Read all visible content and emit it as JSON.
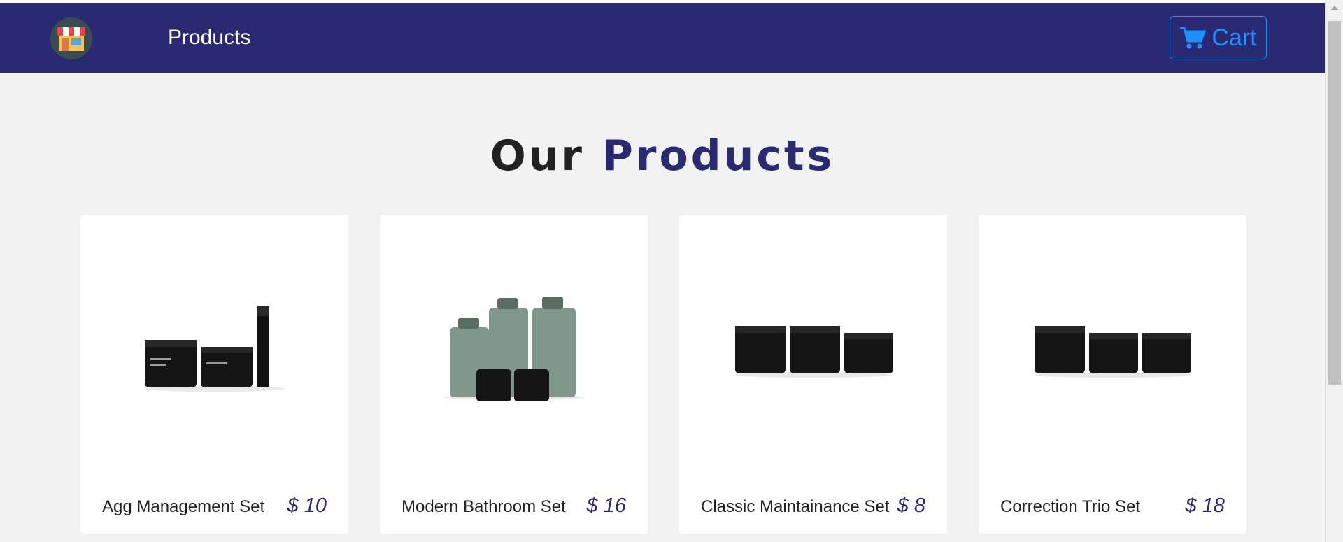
{
  "nav": {
    "logo_icon": "storefront-icon",
    "products_link": "Products",
    "cart_label": "Cart",
    "cart_icon": "shopping-cart-icon"
  },
  "heading": {
    "part1": "Our",
    "part2": "Products"
  },
  "colors": {
    "navbar": "#2a2a72",
    "accent": "#2a2a72",
    "cart": "#1e90ff",
    "background": "#f2f2f2"
  },
  "products": [
    {
      "name": "Agg Management Set",
      "price": "$ 10",
      "image_icon": "skincare-set-image"
    },
    {
      "name": "Modern Bathroom Set",
      "price": "$ 16",
      "image_icon": "bathroom-set-image"
    },
    {
      "name": "Classic Maintainance Set",
      "price": "$ 8",
      "image_icon": "jar-trio-image"
    },
    {
      "name": "Correction Trio Set",
      "price": "$ 18",
      "image_icon": "jar-trio-image"
    }
  ]
}
